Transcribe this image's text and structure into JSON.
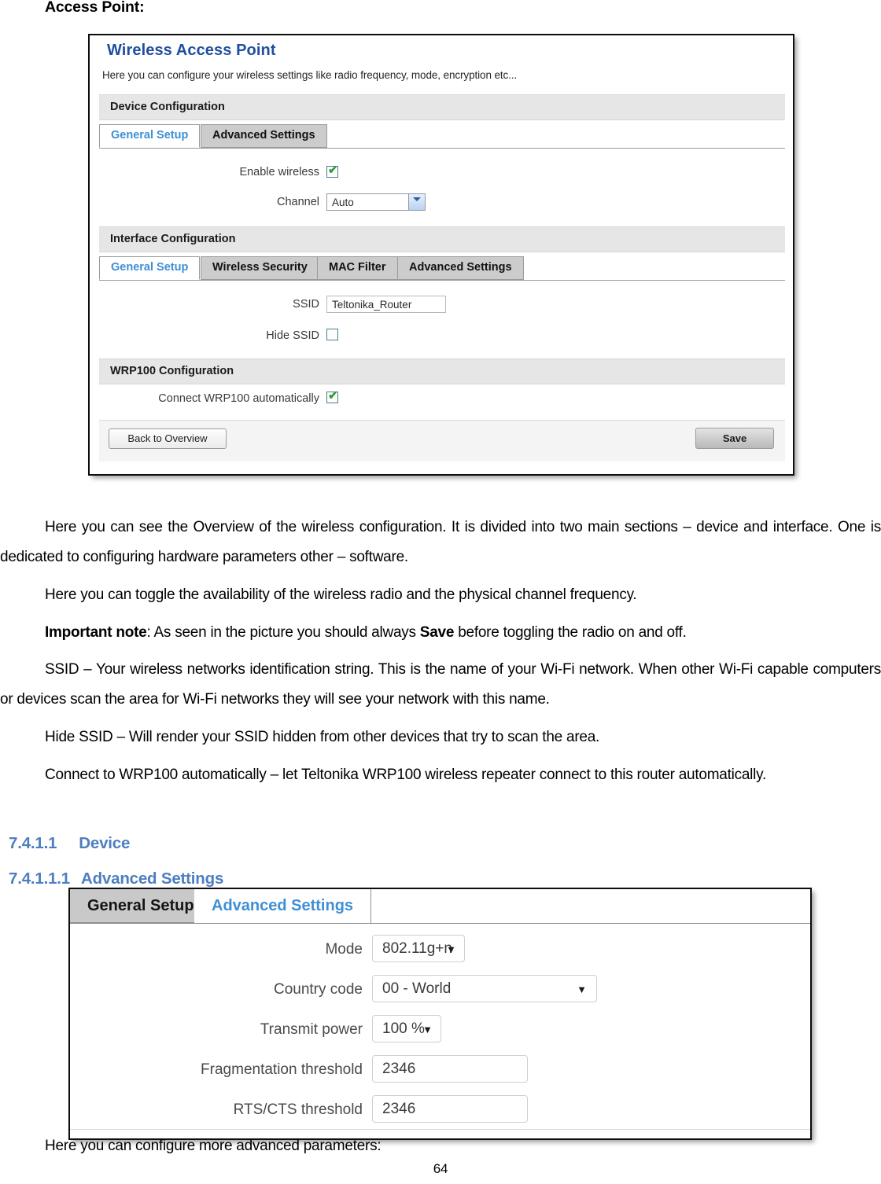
{
  "document": {
    "section_label": "Access Point:",
    "paragraphs": [
      "Here you can see the Overview of the wireless configuration. It is divided into two main sections – device and interface. One is dedicated to configuring hardware parameters other – software.",
      "Here you can toggle the availability of the wireless radio and the physical channel frequency.",
      "SSID – Your wireless networks identification string. This is the name of your Wi-Fi network. When other Wi-Fi capable computers or devices scan the area for Wi-Fi networks they will see your network with this name.",
      "Hide SSID – Will render your SSID hidden from other devices that try to scan the area.",
      "Connect to WRP100 automatically – let Teltonika WRP100 wireless repeater connect to this router automatically.",
      "Here you can configure more advanced parameters:"
    ],
    "important_note": {
      "bold_lead": "Important note",
      "text_before_save": ": As seen in the picture you should always ",
      "save_word": "Save",
      "text_after_save": " before toggling the radio on and off."
    },
    "headings": [
      {
        "number": "7.4.1.1",
        "title": "Device"
      },
      {
        "number": "7.4.1.1.1",
        "title": "Advanced Settings"
      }
    ],
    "page_number": "64",
    "heading_color": "#4d7ebf"
  },
  "access_point_screenshot": {
    "title": "Wireless Access Point",
    "title_color": "#1f4e9c",
    "subtitle": "Here you can configure your wireless settings like radio frequency, mode, encryption etc...",
    "device_section": {
      "legend": "Device Configuration",
      "tabs": [
        {
          "label": "General Setup",
          "active": true
        },
        {
          "label": "Advanced Settings",
          "active": false
        }
      ],
      "fields": [
        {
          "label": "Enable wireless",
          "type": "checkbox",
          "checked": true
        },
        {
          "label": "Channel",
          "type": "select",
          "value": "Auto"
        }
      ]
    },
    "interface_section": {
      "legend": "Interface Configuration",
      "tabs": [
        {
          "label": "General Setup",
          "active": true
        },
        {
          "label": "Wireless Security",
          "active": false
        },
        {
          "label": "MAC Filter",
          "active": false
        },
        {
          "label": "Advanced Settings",
          "active": false
        }
      ],
      "fields": [
        {
          "label": "SSID",
          "type": "text",
          "value": "Teltonika_Router"
        },
        {
          "label": "Hide SSID",
          "type": "checkbox",
          "checked": false
        }
      ]
    },
    "wrp100_section": {
      "legend": "WRP100 Configuration",
      "fields": [
        {
          "label": "Connect WRP100 automatically",
          "type": "checkbox",
          "checked": true
        }
      ]
    },
    "footer": {
      "back_label": "Back to Overview",
      "save_label": "Save"
    }
  },
  "advanced_settings_screenshot": {
    "tabs": [
      {
        "label": "General Setup",
        "active": false
      },
      {
        "label": "Advanced Settings",
        "active": true
      }
    ],
    "fields": [
      {
        "label": "Mode",
        "type": "select",
        "value": "802.11g+n"
      },
      {
        "label": "Country code",
        "type": "select",
        "value": "00 - World"
      },
      {
        "label": "Transmit power",
        "type": "select",
        "value": "100 %"
      },
      {
        "label": "Fragmentation threshold",
        "type": "text",
        "value": "2346"
      },
      {
        "label": "RTS/CTS threshold",
        "type": "text",
        "value": "2346"
      }
    ]
  }
}
